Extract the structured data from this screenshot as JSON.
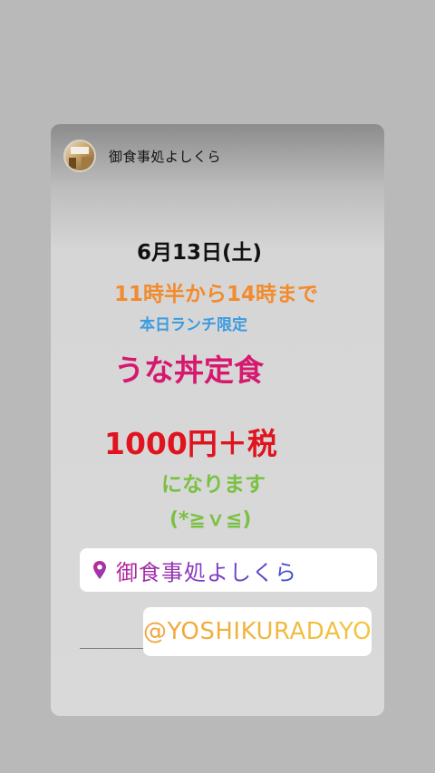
{
  "header": {
    "account_name": "御食事処よしくら"
  },
  "post": {
    "date": "6月13日(土)",
    "hours": "11時半から14時まで",
    "limited": "本日ランチ限定",
    "menu_item": "うな丼定食",
    "price": "1000円＋税",
    "closing": "になります",
    "emoticon": "(*≧ｖ≦)"
  },
  "stickers": {
    "location": "御食事処よしくら",
    "mention": "@YOSHIKURADAYO"
  },
  "colors": {
    "hours": "#f28b2e",
    "limited": "#3c9be0",
    "menu": "#d6186f",
    "price": "#e0141f",
    "closing": "#7ac143"
  },
  "icons": {
    "location": "location-pin-icon"
  }
}
